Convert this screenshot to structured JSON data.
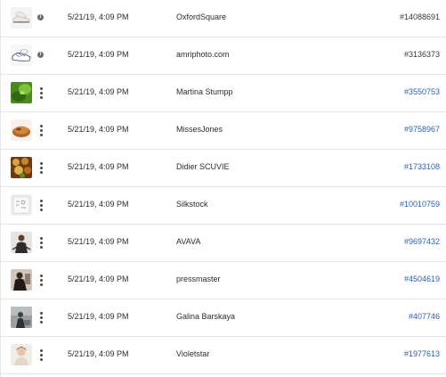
{
  "rows": [
    {
      "thumbnail": "white-sneakers-thumbnail",
      "action_icon": "info-icon",
      "date": "5/21/19, 4:09 PM",
      "author": "OxfordSquare",
      "id": "#14088691",
      "id_style": "plain"
    },
    {
      "thumbnail": "sneaker-outline-thumbnail",
      "action_icon": "info-icon",
      "date": "5/21/19, 4:09 PM",
      "author": "amriphoto.com",
      "id": "#3136373",
      "id_style": "plain"
    },
    {
      "thumbnail": "green-leaf-thumbnail",
      "action_icon": "more-icon",
      "date": "5/21/19, 4:09 PM",
      "author": "Martina Stumpp",
      "id": "#3550753",
      "id_style": "link"
    },
    {
      "thumbnail": "bread-food-thumbnail",
      "action_icon": "more-icon",
      "date": "5/21/19, 4:09 PM",
      "author": "MissesJones",
      "id": "#9758967",
      "id_style": "link"
    },
    {
      "thumbnail": "vegetables-thumbnail",
      "action_icon": "more-icon",
      "date": "5/21/19, 4:09 PM",
      "author": "Didier SCUVIE",
      "id": "#1733108",
      "id_style": "link"
    },
    {
      "thumbnail": "notes-paper-thumbnail",
      "action_icon": "more-icon",
      "date": "5/21/19, 4:09 PM",
      "author": "Silkstock",
      "id": "#10010759",
      "id_style": "link"
    },
    {
      "thumbnail": "person-sitting-thumbnail",
      "action_icon": "more-icon",
      "date": "5/21/19, 4:09 PM",
      "author": "AVAVA",
      "id": "#9697432",
      "id_style": "link"
    },
    {
      "thumbnail": "person-dark-thumbnail",
      "action_icon": "more-icon",
      "date": "5/21/19, 4:09 PM",
      "author": "pressmaster",
      "id": "#4504619",
      "id_style": "link"
    },
    {
      "thumbnail": "person-gray-thumbnail",
      "action_icon": "more-icon",
      "date": "5/21/19, 4:09 PM",
      "author": "Galina Barskaya",
      "id": "#407746",
      "id_style": "link"
    },
    {
      "thumbnail": "woman-portrait-thumbnail",
      "action_icon": "more-icon",
      "date": "5/21/19, 4:09 PM",
      "author": "Violetstar",
      "id": "#1977613",
      "id_style": "link"
    }
  ],
  "colors": {
    "link": "#2d5fa8",
    "plain_id": "#3a3a3a",
    "divider": "#e6e6e6"
  }
}
